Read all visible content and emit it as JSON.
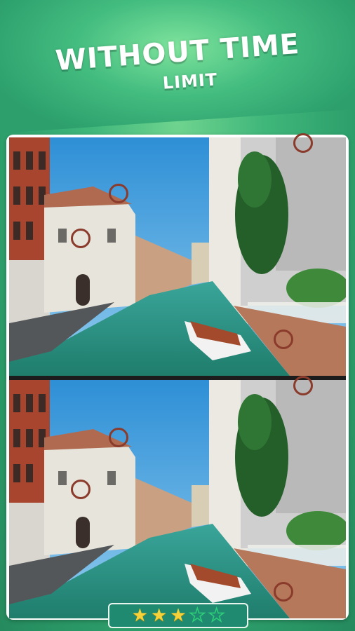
{
  "header": {
    "title_line1": "WITHOUT TIME",
    "title_line2": "LIMIT"
  },
  "images": {
    "top_label": "",
    "bottom_label": ""
  },
  "markers": {
    "count": 5,
    "color": "#8a3b2b"
  },
  "rating": {
    "filled": 3,
    "total": 5,
    "filled_color": "#f5d23a",
    "empty_color": "#2fd07a",
    "stars": [
      "star-filled",
      "star-filled",
      "star-filled",
      "star-empty",
      "star-empty"
    ]
  },
  "colors": {
    "background": "#2d9f6b",
    "frame": "#ffffff",
    "star_bar": "#1f8a70"
  }
}
